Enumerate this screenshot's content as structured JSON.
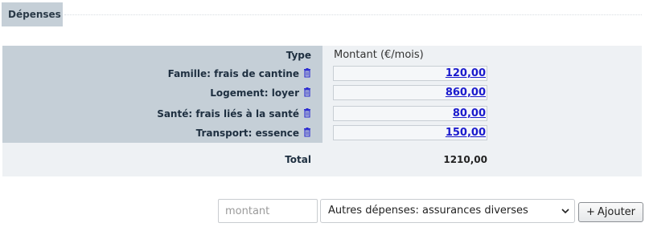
{
  "section": {
    "tab_label": "Dépenses"
  },
  "table": {
    "type_header": "Type",
    "amount_header": "Montant (€/mois)",
    "rows": [
      {
        "label": "Famille: frais de cantine",
        "amount": "120,00"
      },
      {
        "label": "Logement: loyer",
        "amount": "860,00"
      },
      {
        "label": "Santé: frais liés à la santé",
        "amount": "80,00"
      },
      {
        "label": "Transport: essence",
        "amount": "150,00"
      }
    ],
    "total_label": "Total",
    "total_value": "1210,00"
  },
  "add_form": {
    "amount_placeholder": "montant",
    "selected_type": "Autres dépenses: assurances diverses",
    "add_label": "Ajouter",
    "add_icon": "+"
  },
  "colors": {
    "link": "#1a1acd",
    "label_column_bg": "#c5cfd7",
    "panel_bg": "#eef1f4"
  }
}
